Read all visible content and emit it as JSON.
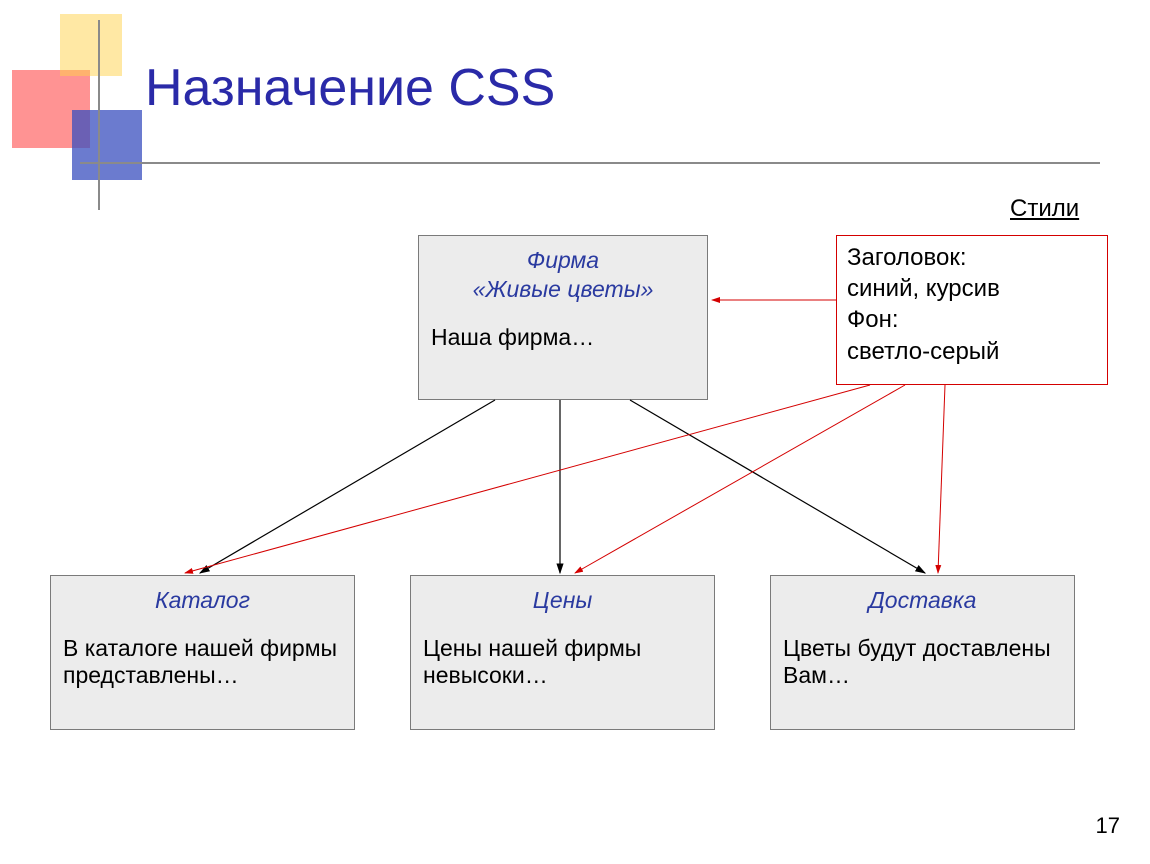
{
  "title": "Назначение CSS",
  "styles_label": "Стили",
  "styles_box": {
    "line1": "Заголовок:",
    "line2": "синий, курсив",
    "line3": "Фон:",
    "line4": "светло-серый"
  },
  "main_box": {
    "title_line1": "Фирма",
    "title_line2": "«Живые цветы»",
    "body": "Наша фирма…"
  },
  "child_boxes": [
    {
      "title": "Каталог",
      "body": "В каталоге нашей фирмы представлены…"
    },
    {
      "title": "Цены",
      "body": "Цены нашей фирмы невысоки…"
    },
    {
      "title": "Доставка",
      "body": "Цветы будут доставлены Вам…"
    }
  ],
  "page_number": "17"
}
